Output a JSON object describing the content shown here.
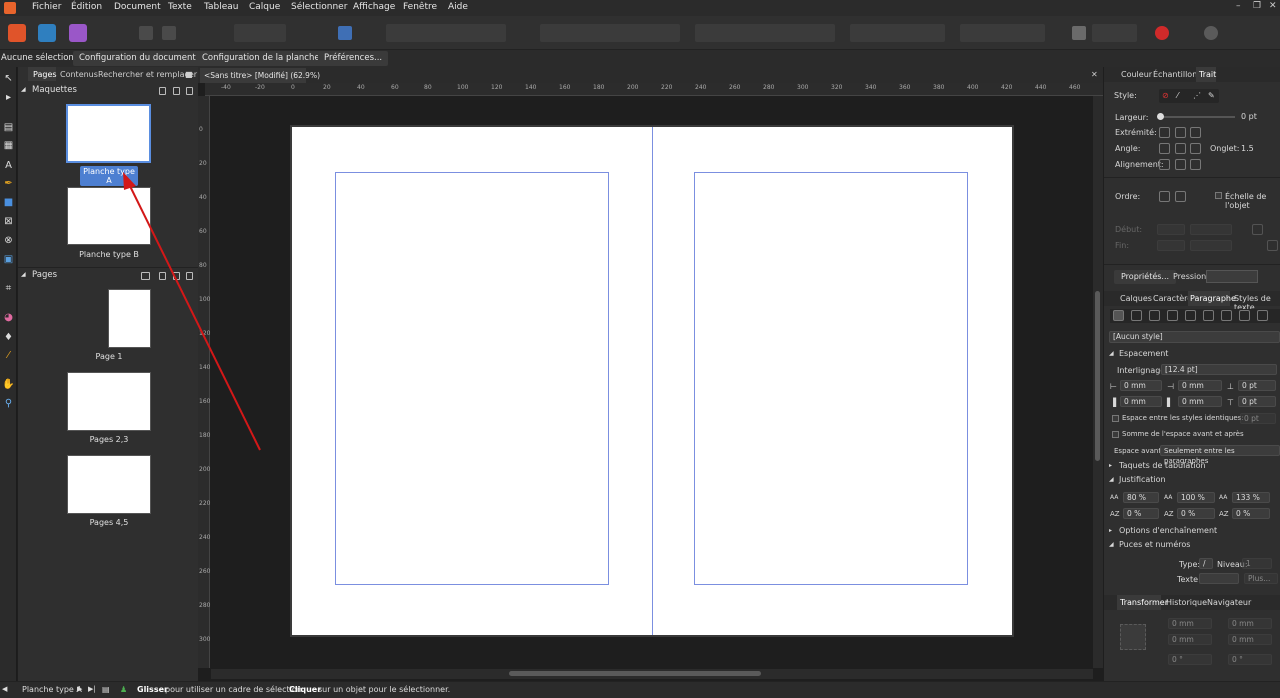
{
  "menubar": {
    "items": [
      "Fichier",
      "Édition",
      "Document",
      "Texte",
      "Tableau",
      "Calque",
      "Sélectionner",
      "Affichage",
      "Fenêtre",
      "Aide"
    ]
  },
  "context_toolbar": {
    "selection_label": "Aucune sélection",
    "buttons": [
      "Configuration du document...",
      "Configuration de la planche...",
      "Préférences..."
    ]
  },
  "pages_panel": {
    "tabs": [
      "Pages",
      "Contenus",
      "Rechercher et remplacer"
    ],
    "masters_title": "Maquettes",
    "masters": [
      "Planche type A",
      "Planche type B"
    ],
    "pages_title": "Pages",
    "pages": [
      "Page 1",
      "Pages 2,3",
      "Pages 4,5"
    ]
  },
  "document": {
    "tab_title": "<Sans titre> [Modifié] (62.9%)",
    "ruler_top": [
      "-40",
      "-20",
      "0",
      "20",
      "40",
      "60",
      "80",
      "100",
      "120",
      "140",
      "160",
      "180",
      "200",
      "220",
      "240",
      "260",
      "280",
      "300",
      "320",
      "340",
      "360",
      "380",
      "400",
      "420",
      "440",
      "460"
    ],
    "ruler_left": [
      "0",
      "20",
      "40",
      "60",
      "80",
      "100",
      "120",
      "140",
      "160",
      "180",
      "200",
      "220",
      "240",
      "260",
      "280",
      "300"
    ]
  },
  "stroke_panel": {
    "tabs": [
      "Couleur",
      "Échantillons",
      "Trait"
    ],
    "style_label": "Style:",
    "width_label": "Largeur:",
    "width_value": "0 pt",
    "cap_label": "Extrémité:",
    "join_label": "Angle:",
    "miter_label": "Onglet:",
    "miter_value": "1.5",
    "align_label": "Alignement:",
    "order_label": "Ordre:",
    "scale_label": "Échelle de l'objet",
    "start_label": "Début:",
    "end_label": "Fin:",
    "properties_button": "Propriétés...",
    "pressure_label": "Pression:"
  },
  "paragraph_panel": {
    "tabs": [
      "Calques",
      "Caractère",
      "Paragraphe",
      "Styles de texte"
    ],
    "style_value": "[Aucun style]",
    "spacing_title": "Espacement",
    "leading_label": "Interlignage:",
    "leading_value": "[12.4 pt]",
    "indent_values": [
      "0 mm",
      "0 mm",
      "0 pt",
      "0 mm",
      "0 mm",
      "0 pt"
    ],
    "same_style_label": "Espace entre les styles identiques:",
    "same_style_value": "0 pt",
    "sum_label": "Somme de l'espace avant et après",
    "space_before_label": "Espace avant:",
    "space_before_value": "Seulement entre les paragraphes",
    "tabs_section": "Taquets de tabulation",
    "justification_title": "Justification",
    "justification_values": [
      "80 %",
      "100 %",
      "133 %",
      "0 %",
      "0 %",
      "0 %"
    ],
    "flow_section": "Options d'enchaînement",
    "bullets_section": "Puces et numéros",
    "type_label": "Type:",
    "type_value": "/",
    "level_label": "Niveau:",
    "level_value": "1",
    "text_label": "Texte:",
    "more_button": "Plus..."
  },
  "transform_panel": {
    "tabs": [
      "Transformer",
      "Historique",
      "Navigateur"
    ],
    "fields": [
      "0 mm",
      "0 mm",
      "0 mm",
      "0 mm",
      "0 °",
      "0 °"
    ]
  },
  "statusbar": {
    "page_label": "Planche type A",
    "hint_bold1": "Glisser",
    "hint_text1": "pour utiliser un cadre de sélection.",
    "hint_bold2": "Cliquer",
    "hint_text2": "sur un objet pour le sélectionner."
  }
}
